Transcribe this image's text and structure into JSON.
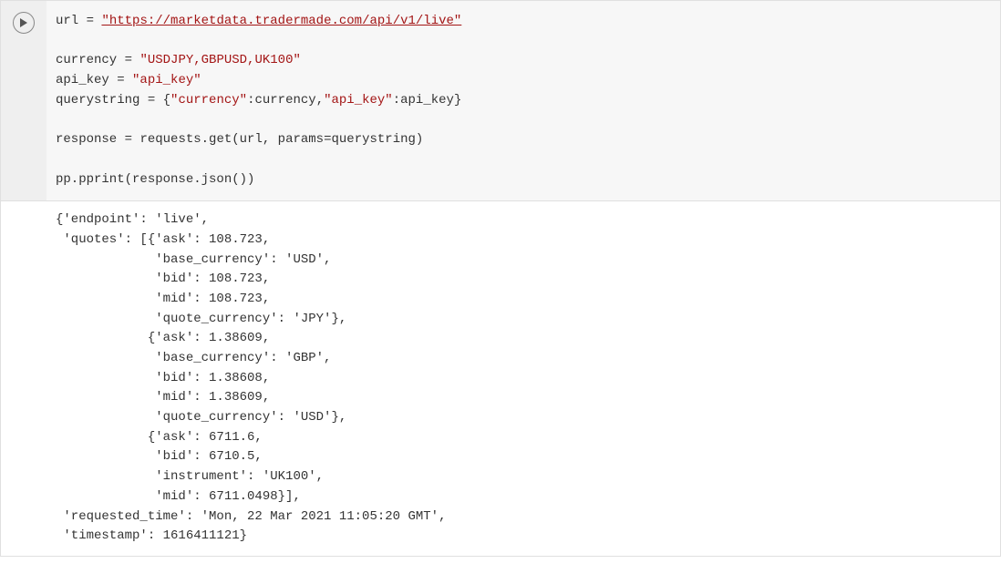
{
  "code": {
    "line1_var": "url",
    "line1_eq": " = ",
    "line1_url": "\"https://marketdata.tradermade.com/api/v1/live\"",
    "line3_var": "currency",
    "line3_eq": " = ",
    "line3_val": "\"USDJPY,GBPUSD,UK100\"",
    "line4_var": "api_key",
    "line4_eq": " = ",
    "line4_val": "\"api_key\"",
    "line5_var": "querystring",
    "line5_eq": " = ",
    "line5_open": "{",
    "line5_key1": "\"currency\"",
    "line5_colon1": ":",
    "line5_val1": "currency",
    "line5_comma": ",",
    "line5_key2": "\"api_key\"",
    "line5_colon2": ":",
    "line5_val2": "api_key",
    "line5_close": "}",
    "line7_var": "response",
    "line7_eq": " = ",
    "line7_call": "requests.get(url, params",
    "line7_eq2": "=",
    "line7_arg": "querystring)",
    "line9": "pp.pprint(response.json())"
  },
  "output": {
    "text": "{'endpoint': 'live',\n 'quotes': [{'ask': 108.723,\n             'base_currency': 'USD',\n             'bid': 108.723,\n             'mid': 108.723,\n             'quote_currency': 'JPY'},\n            {'ask': 1.38609,\n             'base_currency': 'GBP',\n             'bid': 1.38608,\n             'mid': 1.38609,\n             'quote_currency': 'USD'},\n            {'ask': 6711.6,\n             'bid': 6710.5,\n             'instrument': 'UK100',\n             'mid': 6711.0498}],\n 'requested_time': 'Mon, 22 Mar 2021 11:05:20 GMT',\n 'timestamp': 1616411121}"
  }
}
